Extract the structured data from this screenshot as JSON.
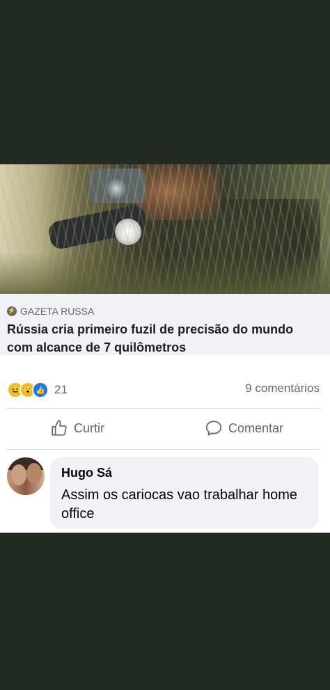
{
  "post": {
    "source": "GAZETA RUSSA",
    "headline": "Rússia cria primeiro fuzil de precisão do mundo com alcance de 7 quilômetros",
    "reaction_count": "21",
    "comments_label": "9 comentários",
    "reactions": [
      "haha",
      "wow",
      "like"
    ]
  },
  "actions": {
    "like_label": "Curtir",
    "comment_label": "Comentar"
  },
  "comment": {
    "author": "Hugo Sá",
    "text": "Assim os cariocas vao trabalhar home office"
  },
  "colors": {
    "background": "#212b22",
    "muted_text": "#65676b",
    "like_blue": "#1877f2",
    "reaction_yellow": "#f7b928"
  }
}
